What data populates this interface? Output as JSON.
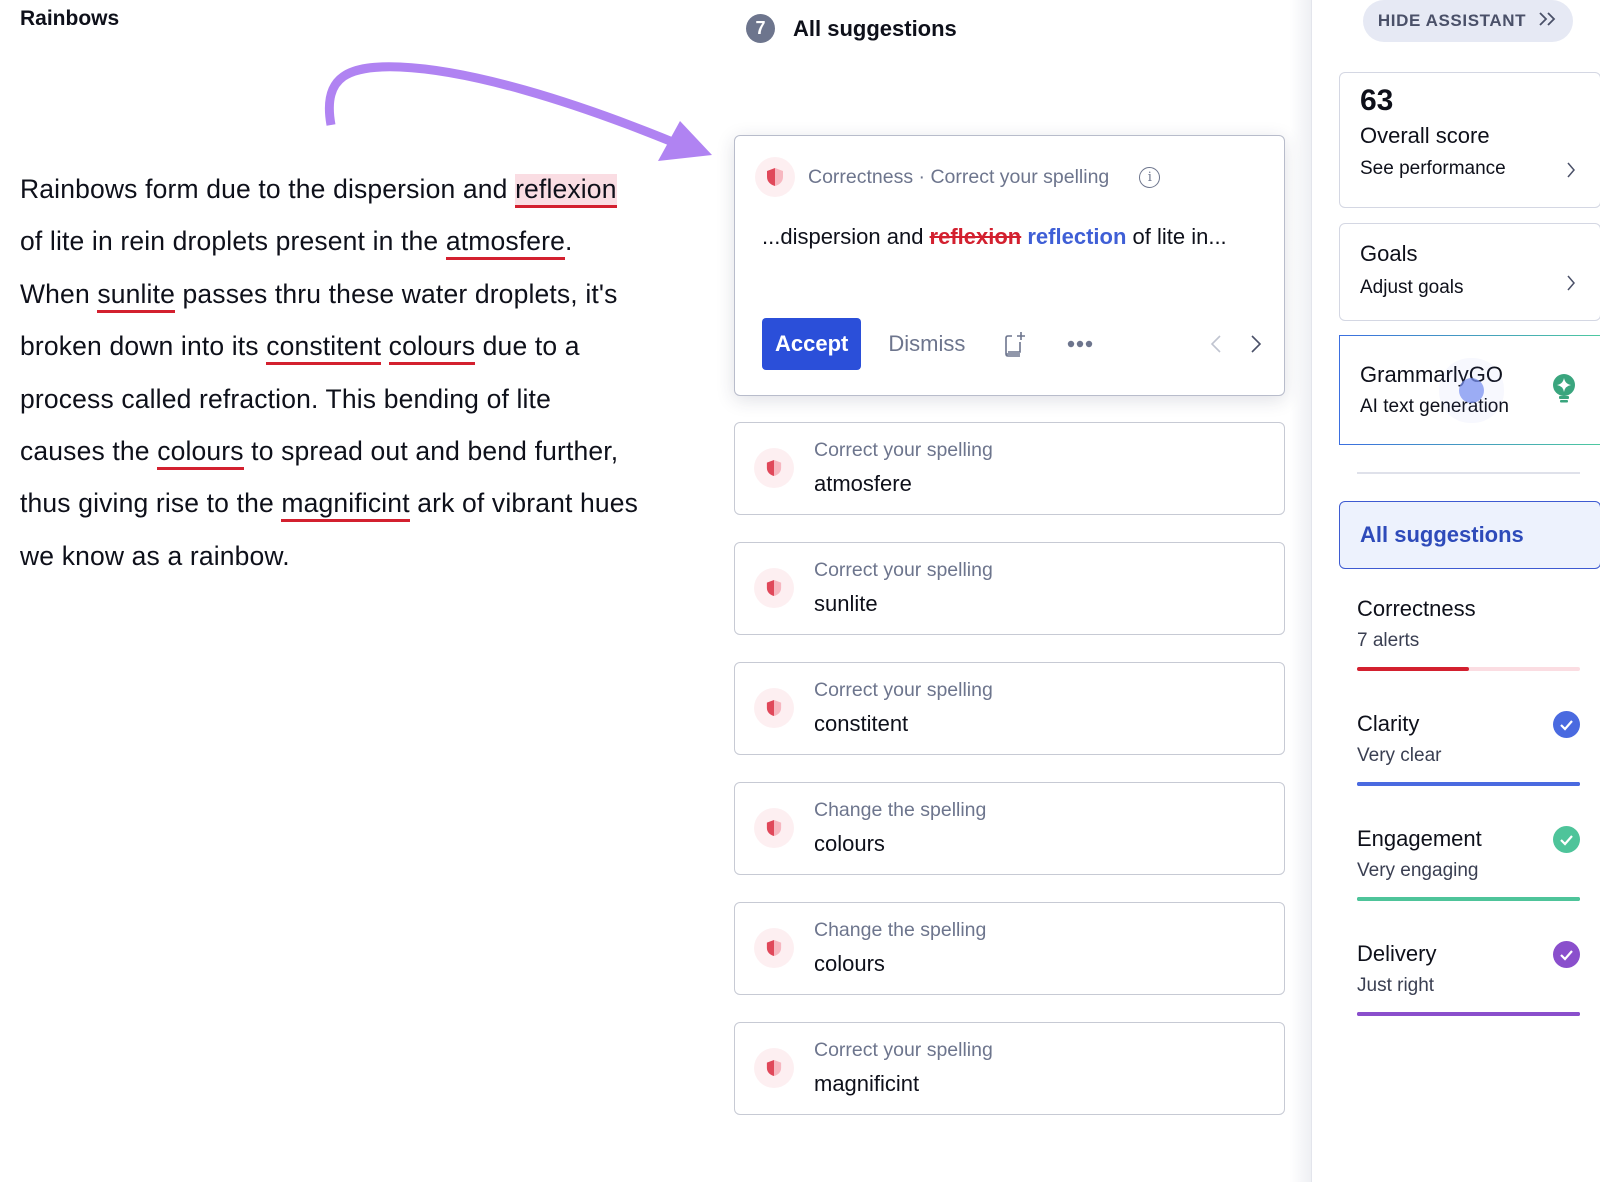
{
  "document": {
    "title": "Rainbows",
    "paragraph": [
      {
        "t": "Rainbows form due to the dispersion and "
      },
      {
        "t": "reflexion",
        "err": true,
        "active": true
      },
      {
        "t": " of lite in rein droplets present in the "
      },
      {
        "t": "atmosfere",
        "err": true
      },
      {
        "t": ". When "
      },
      {
        "t": "sunlite",
        "err": true
      },
      {
        "t": " passes thru these water droplets, it's broken down into its "
      },
      {
        "t": "constitent",
        "err": true
      },
      {
        "t": " "
      },
      {
        "t": "colours",
        "err": true
      },
      {
        "t": " due to a process called refraction. This bending of lite causes the "
      },
      {
        "t": "colours",
        "err": true
      },
      {
        "t": " to spread out and bend further, thus giving rise to the "
      },
      {
        "t": "magnificint",
        "err": true
      },
      {
        "t": " ark of vibrant hues we know as a rainbow."
      }
    ]
  },
  "suggestions": {
    "count": "7",
    "title": "All suggestions",
    "active": {
      "category": "Correctness · Correct your spelling",
      "info_icon": "info-icon",
      "prefix": "...dispersion and ",
      "wrong": "reflexion",
      "replacement": "reflection",
      "suffix": " of lite in...",
      "accept_label": "Accept",
      "dismiss_label": "Dismiss",
      "icons": [
        "add-to-dictionary-icon",
        "more-options-icon",
        "chevron-left-icon",
        "chevron-right-icon"
      ]
    },
    "items": [
      {
        "label": "Correct your spelling",
        "word": "atmosfere"
      },
      {
        "label": "Correct your spelling",
        "word": "sunlite"
      },
      {
        "label": "Correct your spelling",
        "word": "constitent"
      },
      {
        "label": "Change the spelling",
        "word": "colours"
      },
      {
        "label": "Change the spelling",
        "word": "colours"
      },
      {
        "label": "Correct your spelling",
        "word": "magnificint"
      }
    ]
  },
  "sidebar": {
    "hide_label": "HIDE ASSISTANT",
    "score": {
      "value": "63",
      "title": "Overall score",
      "link": "See performance"
    },
    "goals": {
      "title": "Goals",
      "link": "Adjust goals"
    },
    "go": {
      "title": "GrammarlyGO",
      "subtitle": "AI text generation"
    },
    "all_suggestions_label": "All suggestions",
    "categories": [
      {
        "name": "Correctness",
        "status": "7 alerts",
        "color": "#d3202f",
        "track": "#fbdde2",
        "progress": 0.5,
        "checked": false
      },
      {
        "name": "Clarity",
        "status": "Very clear",
        "color": "#4a6ae0",
        "track": "#4a6ae0",
        "progress": 1.0,
        "checked": true
      },
      {
        "name": "Engagement",
        "status": "Very engaging",
        "color": "#4ec49a",
        "track": "#4ec49a",
        "progress": 1.0,
        "checked": true
      },
      {
        "name": "Delivery",
        "status": "Just right",
        "color": "#8a4fcc",
        "track": "#8a4fcc",
        "progress": 1.0,
        "checked": true
      }
    ]
  },
  "colors": {
    "accent": "#2b4fd9",
    "error": "#d3202f",
    "arrow": "#b083f2"
  }
}
